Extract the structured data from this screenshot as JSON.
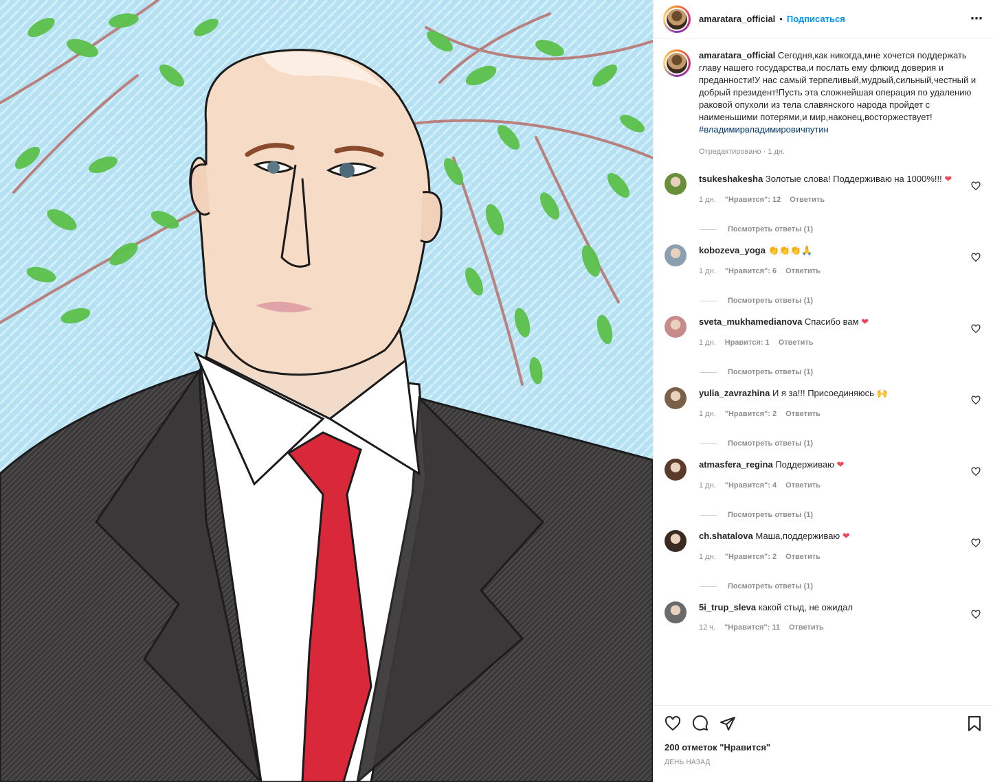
{
  "post": {
    "username": "amaratara_official",
    "dot": "•",
    "follow_label": "Подписаться",
    "more_icon": "⋯",
    "caption": "Сегодня,как никогда,мне хочется поддержать главу нашего государства,и послать ему флюид доверия и преданности!У нас самый терпеливый,мудрый,сильный,честный и добрый президент!Пусть эта сложнейшая операция по удалению раковой опухоли из тела славянского народа пройдет с наименьшими потерями,и мир,наконец,восторжествует!",
    "hashtag": "#владимирвладимировичпутин",
    "edited": "Отредактировано · 1 дн."
  },
  "comments": [
    {
      "user": "tsukeshakesha",
      "text": "Золотые слова! Поддерживаю на 1000%!!!",
      "emoji": "❤",
      "time": "1 дн.",
      "likes": "\"Нравится\": 12",
      "reply": "Ответить",
      "view": "Посмотреть ответы (1)",
      "avatar": "#6a8f3a"
    },
    {
      "user": "kobozeva_yoga",
      "text": "",
      "emoji": "👏👏👏🙏",
      "time": "1 дн.",
      "likes": "\"Нравится\": 6",
      "reply": "Ответить",
      "view": "Посмотреть ответы (1)",
      "avatar": "#8aa0b0"
    },
    {
      "user": "sveta_mukhamedianova",
      "text": "Спасибо вам",
      "emoji": "❤",
      "time": "1 дн.",
      "likes": "Нравится: 1",
      "reply": "Ответить",
      "view": "Посмотреть ответы (1)",
      "avatar": "#c98a8a"
    },
    {
      "user": "yulia_zavrazhina",
      "text": "И я за!!! Присоединяюсь",
      "emoji": "🙌",
      "time": "1 дн.",
      "likes": "\"Нравится\": 2",
      "reply": "Ответить",
      "view": "Посмотреть ответы (1)",
      "avatar": "#7a6048"
    },
    {
      "user": "atmasfera_regina",
      "text": "Поддерживаю",
      "emoji": "❤",
      "time": "1 дн.",
      "likes": "\"Нравится\": 4",
      "reply": "Ответить",
      "view": "Посмотреть ответы (1)",
      "avatar": "#5a3a2a"
    },
    {
      "user": "ch.shatalova",
      "text": "Маша,поддерживаю",
      "emoji": "❤",
      "time": "1 дн.",
      "likes": "\"Нравится\": 2",
      "reply": "Ответить",
      "view": "Посмотреть ответы (1)",
      "avatar": "#3a2a22"
    },
    {
      "user": "5i_trup_sleva",
      "text": "какой стыд, не ожидал",
      "emoji": "",
      "time": "12 ч.",
      "likes": "\"Нравится\": 11",
      "reply": "Ответить",
      "view": "",
      "avatar": "#6a6a6a"
    }
  ],
  "footer": {
    "likes": "200 отметок \"Нравится\"",
    "date": "ДЕНЬ НАЗАД"
  },
  "colors": {
    "follow": "#0095f6",
    "hashtag": "#00376b",
    "liked_heart": "#ed4956",
    "muted": "#8e8e8e"
  },
  "icons": [
    "heart-icon",
    "comment-icon",
    "share-icon",
    "bookmark-icon",
    "more-icon"
  ]
}
